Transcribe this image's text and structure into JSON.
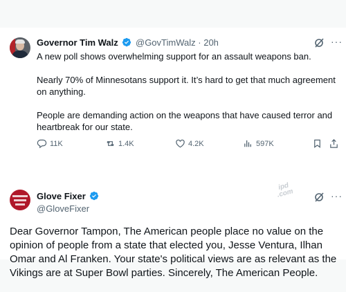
{
  "tweet1": {
    "name": "Governor Tim Walz",
    "handle": "@GovTimWalz",
    "separator": "·",
    "time": "20h",
    "paragraphs": [
      "A new poll shows overwhelming support for an assault weapons ban.",
      "Nearly 70% of Minnesotans support it. It’s hard to get that much agreement on anything.",
      "People are demanding action on the weapons that have caused terror and heartbreak for our state."
    ],
    "stats": {
      "replies": "11K",
      "reposts": "1.4K",
      "likes": "4.2K",
      "views": "597K"
    },
    "more": "···"
  },
  "tweet2": {
    "name": "Glove Fixer",
    "handle": "@GloveFixer",
    "body": "Dear Governor Tampon, The American people place no value on the opinion of people from a state that elected you, Jesse Ventura, Ilhan Omar and Al Franken. Your state's political views are as relevant as the Vikings are at Super Bowl parties. Sincerely, The American People.",
    "more": "···",
    "watermark": "ipd .com"
  },
  "colors": {
    "verified": "#1d9bf0",
    "secondary_text": "#536471",
    "text": "#0f1419"
  },
  "icons": [
    "verified-badge-icon",
    "grok-icon",
    "more-icon",
    "reply-icon",
    "repost-icon",
    "like-icon",
    "views-icon",
    "bookmark-icon",
    "share-icon"
  ]
}
